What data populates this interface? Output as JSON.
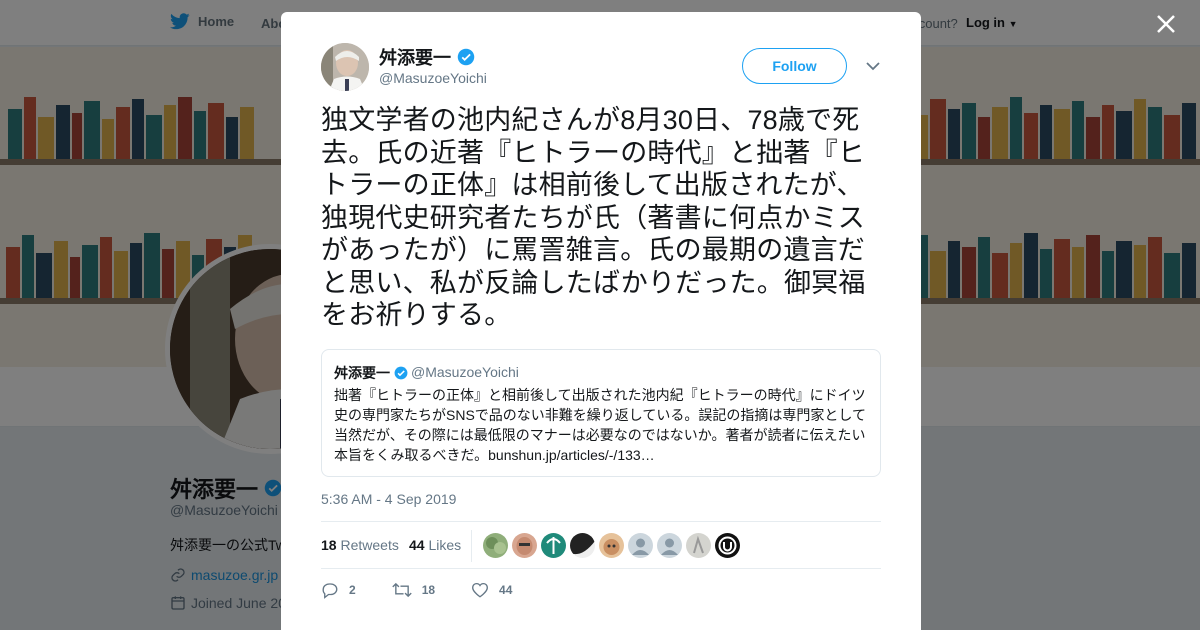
{
  "nav": {
    "home_label": "Home",
    "about_label": "Abo",
    "account_prompt": "account?",
    "login_label": "Log in"
  },
  "profile": {
    "name": "舛添要一",
    "handle": "@MasuzoeYoichi",
    "bio": "舛添要一の公式Tw",
    "url": "masuzoe.gr.jp",
    "joined": "Joined June 20"
  },
  "tweet": {
    "author_name": "舛添要一",
    "author_handle": "@MasuzoeYoichi",
    "follow_label": "Follow",
    "text": "独文学者の池内紀さんが8月30日、78歳で死去。氏の近著『ヒトラーの時代』と拙著『ヒトラーの正体』は相前後して出版されたが、独現代史研究者たちが氏（著書に何点かミスがあったが）に罵詈雑言。氏の最期の遺言だと思い、私が反論したばかりだった。御冥福をお祈りする。",
    "quoted": {
      "author_name": "舛添要一",
      "author_handle": "@MasuzoeYoichi",
      "text": "拙著『ヒトラーの正体』と相前後して出版された池内紀『ヒトラーの時代』にドイツ史の専門家たちがSNSで品のない非難を繰り返している。誤記の指摘は専門家として当然だが、その際には最低限のマナーは必要なのではないか。著者が読者に伝えたい本旨をくみ取るべきだ。",
      "link": "bunshun.jp/articles/-/133…"
    },
    "timestamp": "5:36 AM - 4 Sep 2019",
    "retweets_count": "18",
    "retweets_label": "Retweets",
    "likes_count": "44",
    "likes_label": "Likes",
    "replies": "2",
    "retweets": "18",
    "likes": "44"
  },
  "colors": {
    "accent": "#1da1f2",
    "verified": "#1da1f2",
    "secondary_text": "#657786"
  },
  "icons": [
    "twitter-bird-icon",
    "verified-badge-icon",
    "close-icon",
    "chevron-down-icon",
    "reply-icon",
    "retweet-icon",
    "heart-icon",
    "link-icon",
    "calendar-icon"
  ]
}
